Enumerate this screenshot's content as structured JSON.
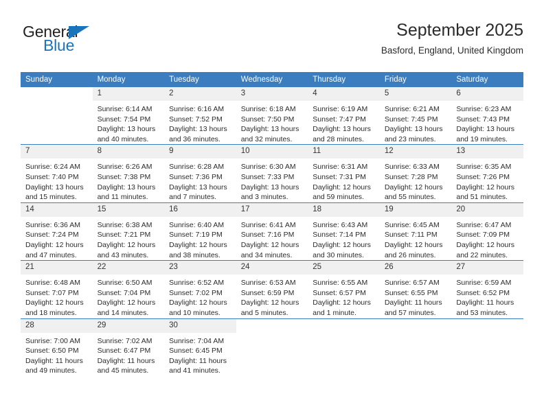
{
  "brand": {
    "name_top": "General",
    "name_bottom": "Blue",
    "accent_color": "#1a74bb"
  },
  "header": {
    "title": "September 2025",
    "subtitle": "Basford, England, United Kingdom"
  },
  "calendar": {
    "header_bg": "#3b7dbf",
    "daynum_bg": "#f0f0f0",
    "weekdays": [
      "Sunday",
      "Monday",
      "Tuesday",
      "Wednesday",
      "Thursday",
      "Friday",
      "Saturday"
    ],
    "labels": {
      "sunrise": "Sunrise:",
      "sunset": "Sunset:",
      "daylight": "Daylight:"
    },
    "weeks": [
      [
        {
          "day": ""
        },
        {
          "day": "1",
          "sunrise": "Sunrise: 6:14 AM",
          "sunset": "Sunset: 7:54 PM",
          "daylight_1": "Daylight: 13 hours",
          "daylight_2": "and 40 minutes."
        },
        {
          "day": "2",
          "sunrise": "Sunrise: 6:16 AM",
          "sunset": "Sunset: 7:52 PM",
          "daylight_1": "Daylight: 13 hours",
          "daylight_2": "and 36 minutes."
        },
        {
          "day": "3",
          "sunrise": "Sunrise: 6:18 AM",
          "sunset": "Sunset: 7:50 PM",
          "daylight_1": "Daylight: 13 hours",
          "daylight_2": "and 32 minutes."
        },
        {
          "day": "4",
          "sunrise": "Sunrise: 6:19 AM",
          "sunset": "Sunset: 7:47 PM",
          "daylight_1": "Daylight: 13 hours",
          "daylight_2": "and 28 minutes."
        },
        {
          "day": "5",
          "sunrise": "Sunrise: 6:21 AM",
          "sunset": "Sunset: 7:45 PM",
          "daylight_1": "Daylight: 13 hours",
          "daylight_2": "and 23 minutes."
        },
        {
          "day": "6",
          "sunrise": "Sunrise: 6:23 AM",
          "sunset": "Sunset: 7:43 PM",
          "daylight_1": "Daylight: 13 hours",
          "daylight_2": "and 19 minutes."
        }
      ],
      [
        {
          "day": "7",
          "sunrise": "Sunrise: 6:24 AM",
          "sunset": "Sunset: 7:40 PM",
          "daylight_1": "Daylight: 13 hours",
          "daylight_2": "and 15 minutes."
        },
        {
          "day": "8",
          "sunrise": "Sunrise: 6:26 AM",
          "sunset": "Sunset: 7:38 PM",
          "daylight_1": "Daylight: 13 hours",
          "daylight_2": "and 11 minutes."
        },
        {
          "day": "9",
          "sunrise": "Sunrise: 6:28 AM",
          "sunset": "Sunset: 7:36 PM",
          "daylight_1": "Daylight: 13 hours",
          "daylight_2": "and 7 minutes."
        },
        {
          "day": "10",
          "sunrise": "Sunrise: 6:30 AM",
          "sunset": "Sunset: 7:33 PM",
          "daylight_1": "Daylight: 13 hours",
          "daylight_2": "and 3 minutes."
        },
        {
          "day": "11",
          "sunrise": "Sunrise: 6:31 AM",
          "sunset": "Sunset: 7:31 PM",
          "daylight_1": "Daylight: 12 hours",
          "daylight_2": "and 59 minutes."
        },
        {
          "day": "12",
          "sunrise": "Sunrise: 6:33 AM",
          "sunset": "Sunset: 7:28 PM",
          "daylight_1": "Daylight: 12 hours",
          "daylight_2": "and 55 minutes."
        },
        {
          "day": "13",
          "sunrise": "Sunrise: 6:35 AM",
          "sunset": "Sunset: 7:26 PM",
          "daylight_1": "Daylight: 12 hours",
          "daylight_2": "and 51 minutes."
        }
      ],
      [
        {
          "day": "14",
          "sunrise": "Sunrise: 6:36 AM",
          "sunset": "Sunset: 7:24 PM",
          "daylight_1": "Daylight: 12 hours",
          "daylight_2": "and 47 minutes."
        },
        {
          "day": "15",
          "sunrise": "Sunrise: 6:38 AM",
          "sunset": "Sunset: 7:21 PM",
          "daylight_1": "Daylight: 12 hours",
          "daylight_2": "and 43 minutes."
        },
        {
          "day": "16",
          "sunrise": "Sunrise: 6:40 AM",
          "sunset": "Sunset: 7:19 PM",
          "daylight_1": "Daylight: 12 hours",
          "daylight_2": "and 38 minutes."
        },
        {
          "day": "17",
          "sunrise": "Sunrise: 6:41 AM",
          "sunset": "Sunset: 7:16 PM",
          "daylight_1": "Daylight: 12 hours",
          "daylight_2": "and 34 minutes."
        },
        {
          "day": "18",
          "sunrise": "Sunrise: 6:43 AM",
          "sunset": "Sunset: 7:14 PM",
          "daylight_1": "Daylight: 12 hours",
          "daylight_2": "and 30 minutes."
        },
        {
          "day": "19",
          "sunrise": "Sunrise: 6:45 AM",
          "sunset": "Sunset: 7:11 PM",
          "daylight_1": "Daylight: 12 hours",
          "daylight_2": "and 26 minutes."
        },
        {
          "day": "20",
          "sunrise": "Sunrise: 6:47 AM",
          "sunset": "Sunset: 7:09 PM",
          "daylight_1": "Daylight: 12 hours",
          "daylight_2": "and 22 minutes."
        }
      ],
      [
        {
          "day": "21",
          "sunrise": "Sunrise: 6:48 AM",
          "sunset": "Sunset: 7:07 PM",
          "daylight_1": "Daylight: 12 hours",
          "daylight_2": "and 18 minutes."
        },
        {
          "day": "22",
          "sunrise": "Sunrise: 6:50 AM",
          "sunset": "Sunset: 7:04 PM",
          "daylight_1": "Daylight: 12 hours",
          "daylight_2": "and 14 minutes."
        },
        {
          "day": "23",
          "sunrise": "Sunrise: 6:52 AM",
          "sunset": "Sunset: 7:02 PM",
          "daylight_1": "Daylight: 12 hours",
          "daylight_2": "and 10 minutes."
        },
        {
          "day": "24",
          "sunrise": "Sunrise: 6:53 AM",
          "sunset": "Sunset: 6:59 PM",
          "daylight_1": "Daylight: 12 hours",
          "daylight_2": "and 5 minutes."
        },
        {
          "day": "25",
          "sunrise": "Sunrise: 6:55 AM",
          "sunset": "Sunset: 6:57 PM",
          "daylight_1": "Daylight: 12 hours",
          "daylight_2": "and 1 minute."
        },
        {
          "day": "26",
          "sunrise": "Sunrise: 6:57 AM",
          "sunset": "Sunset: 6:55 PM",
          "daylight_1": "Daylight: 11 hours",
          "daylight_2": "and 57 minutes."
        },
        {
          "day": "27",
          "sunrise": "Sunrise: 6:59 AM",
          "sunset": "Sunset: 6:52 PM",
          "daylight_1": "Daylight: 11 hours",
          "daylight_2": "and 53 minutes."
        }
      ],
      [
        {
          "day": "28",
          "sunrise": "Sunrise: 7:00 AM",
          "sunset": "Sunset: 6:50 PM",
          "daylight_1": "Daylight: 11 hours",
          "daylight_2": "and 49 minutes."
        },
        {
          "day": "29",
          "sunrise": "Sunrise: 7:02 AM",
          "sunset": "Sunset: 6:47 PM",
          "daylight_1": "Daylight: 11 hours",
          "daylight_2": "and 45 minutes."
        },
        {
          "day": "30",
          "sunrise": "Sunrise: 7:04 AM",
          "sunset": "Sunset: 6:45 PM",
          "daylight_1": "Daylight: 11 hours",
          "daylight_2": "and 41 minutes."
        },
        {
          "day": ""
        },
        {
          "day": ""
        },
        {
          "day": ""
        },
        {
          "day": ""
        }
      ]
    ]
  }
}
